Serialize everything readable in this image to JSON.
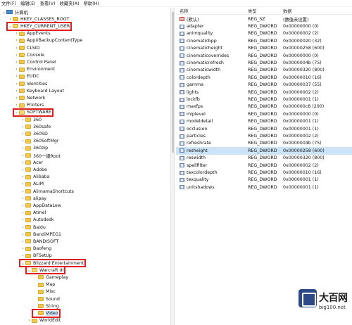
{
  "menu": [
    "文件(F)",
    "编辑(E)",
    "查看(V)",
    "收藏夹(A)",
    "帮助(H)"
  ],
  "tree": [
    {
      "label": "计算机",
      "level": 0,
      "expanded": true,
      "icon": "computer"
    },
    {
      "label": "HKEY_CLASSES_ROOT",
      "level": 1,
      "expanded": false
    },
    {
      "label": "HKEY_CURRENT_USER",
      "level": 1,
      "expanded": true,
      "highlighted": true
    },
    {
      "label": "AppEvents",
      "level": 2,
      "expanded": false
    },
    {
      "label": "AppXBackupContentType",
      "level": 2,
      "expanded": false
    },
    {
      "label": "CLSID",
      "level": 2,
      "expanded": false
    },
    {
      "label": "Console",
      "level": 2,
      "expanded": false
    },
    {
      "label": "Control Panel",
      "level": 2,
      "expanded": false
    },
    {
      "label": "Environment",
      "level": 2,
      "expanded": false
    },
    {
      "label": "EUDC",
      "level": 2,
      "expanded": false
    },
    {
      "label": "Identities",
      "level": 2,
      "expanded": false
    },
    {
      "label": "Keyboard Layout",
      "level": 2,
      "expanded": false
    },
    {
      "label": "Network",
      "level": 2,
      "expanded": false
    },
    {
      "label": "Printers",
      "level": 2,
      "expanded": false
    },
    {
      "label": "SOFTWARE",
      "level": 2,
      "expanded": true,
      "highlighted": true
    },
    {
      "label": "360",
      "level": 3,
      "expanded": false
    },
    {
      "label": "360safe",
      "level": 3,
      "expanded": false
    },
    {
      "label": "360SD",
      "level": 3,
      "expanded": false
    },
    {
      "label": "360SoftMgr",
      "level": 3,
      "expanded": false
    },
    {
      "label": "360zip",
      "level": 3,
      "expanded": false
    },
    {
      "label": "360一键Root",
      "level": 3,
      "expanded": false
    },
    {
      "label": "Acer",
      "level": 3,
      "expanded": false
    },
    {
      "label": "Adobe",
      "level": 3,
      "expanded": false
    },
    {
      "label": "Alibaba",
      "level": 3,
      "expanded": false
    },
    {
      "label": "ALIM",
      "level": 3,
      "expanded": false
    },
    {
      "label": "AlimamaShortcuts",
      "level": 3,
      "expanded": false
    },
    {
      "label": "alipay",
      "level": 3,
      "expanded": false
    },
    {
      "label": "AppDataLow",
      "level": 3,
      "expanded": false
    },
    {
      "label": "Atmel",
      "level": 3,
      "expanded": false
    },
    {
      "label": "Autodesk",
      "level": 3,
      "expanded": false
    },
    {
      "label": "Baidu",
      "level": 3,
      "expanded": false
    },
    {
      "label": "BandiMPEG1",
      "level": 3,
      "expanded": false
    },
    {
      "label": "BANDISOFT",
      "level": 3,
      "expanded": false
    },
    {
      "label": "Baofeng",
      "level": 3,
      "expanded": false
    },
    {
      "label": "BFSetUp",
      "level": 3,
      "expanded": false
    },
    {
      "label": "Blizzard Entertainment",
      "level": 3,
      "expanded": true,
      "highlighted": true
    },
    {
      "label": "Warcraft III",
      "level": 4,
      "expanded": true,
      "highlighted": true
    },
    {
      "label": "Gameplay",
      "level": 5,
      "leaf": true
    },
    {
      "label": "Map",
      "level": 5,
      "leaf": true
    },
    {
      "label": "Misc",
      "level": 5,
      "leaf": true
    },
    {
      "label": "Sound",
      "level": 5,
      "leaf": true
    },
    {
      "label": "String",
      "level": 5,
      "leaf": true
    },
    {
      "label": "Video",
      "level": 5,
      "leaf": true,
      "selected": true,
      "highlighted": true
    },
    {
      "label": "WorldEdit",
      "level": 4,
      "expanded": false
    }
  ],
  "list": {
    "headers": {
      "name": "名称",
      "type": "类型",
      "data": "数据"
    },
    "rows": [
      {
        "name": "(默认)",
        "type": "REG_SZ",
        "data": "(数值未设置)",
        "icon": "string-value-icon"
      },
      {
        "name": "adapter",
        "type": "REG_DWORD",
        "data": "0x00000000 (0)"
      },
      {
        "name": "animquality",
        "type": "REG_DWORD",
        "data": "0x00000002 (2)"
      },
      {
        "name": "cinematicbpp",
        "type": "REG_DWORD",
        "data": "0x00000020 (32)"
      },
      {
        "name": "cinematicheight",
        "type": "REG_DWORD",
        "data": "0x00000258 (600)"
      },
      {
        "name": "cinematicoverrides",
        "type": "REG_DWORD",
        "data": "0x00000000 (0)"
      },
      {
        "name": "cinematicrefresh",
        "type": "REG_DWORD",
        "data": "0x0000004b (75)"
      },
      {
        "name": "cinematicwidth",
        "type": "REG_DWORD",
        "data": "0x00000320 (800)"
      },
      {
        "name": "colordepth",
        "type": "REG_DWORD",
        "data": "0x00000010 (16)"
      },
      {
        "name": "gamma",
        "type": "REG_DWORD",
        "data": "0x00000037 (55)"
      },
      {
        "name": "lights",
        "type": "REG_DWORD",
        "data": "0x00000002 (2)"
      },
      {
        "name": "lockfb",
        "type": "REG_DWORD",
        "data": "0x00000001 (1)"
      },
      {
        "name": "maxfps",
        "type": "REG_DWORD",
        "data": "0x000000c8 (200)"
      },
      {
        "name": "miplevel",
        "type": "REG_DWORD",
        "data": "0x00000000 (0)"
      },
      {
        "name": "modeldetail",
        "type": "REG_DWORD",
        "data": "0x00000001 (1)"
      },
      {
        "name": "occlusion",
        "type": "REG_DWORD",
        "data": "0x00000001 (1)"
      },
      {
        "name": "particles",
        "type": "REG_DWORD",
        "data": "0x00000002 (2)"
      },
      {
        "name": "refreshrate",
        "type": "REG_DWORD",
        "data": "0x0000004b (75)"
      },
      {
        "name": "resheight",
        "type": "REG_DWORD",
        "data": "0x00000258 (600)",
        "selected": true
      },
      {
        "name": "reswidth",
        "type": "REG_DWORD",
        "data": "0x00000320 (800)"
      },
      {
        "name": "spellfilter",
        "type": "REG_DWORD",
        "data": "0x00000002 (2)"
      },
      {
        "name": "texcolordepth",
        "type": "REG_DWORD",
        "data": "0x00000010 (16)"
      },
      {
        "name": "texquality",
        "type": "REG_DWORD",
        "data": "0x00000001 (1)"
      },
      {
        "name": "unitshadows",
        "type": "REG_DWORD",
        "data": "0x00000001 (1)"
      }
    ]
  },
  "watermark": {
    "title": "大百网",
    "subtitle": "big100.net"
  },
  "colors": {
    "highlight_box": "#e02020",
    "selection": "#cce4f7",
    "folder": "#f2c94c"
  }
}
